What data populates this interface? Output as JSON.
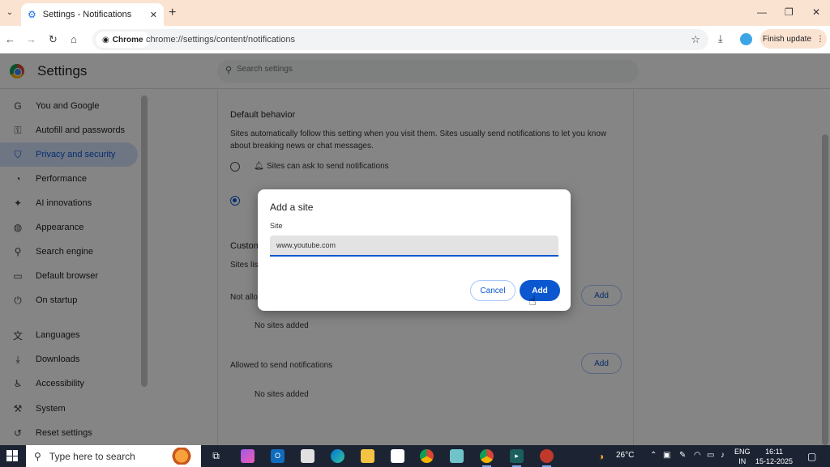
{
  "browser": {
    "tab_title": "Settings - Notifications",
    "site_chip": "Chrome",
    "url": "chrome://settings/content/notifications",
    "finish_update": "Finish update"
  },
  "settings": {
    "title": "Settings",
    "search_placeholder": "Search settings",
    "sidebar": [
      {
        "label": "You and Google",
        "icon": "google-icon"
      },
      {
        "label": "Autofill and passwords",
        "icon": "key-icon"
      },
      {
        "label": "Privacy and security",
        "icon": "shield-icon"
      },
      {
        "label": "Performance",
        "icon": "speedometer-icon"
      },
      {
        "label": "AI innovations",
        "icon": "sparkle-icon"
      },
      {
        "label": "Appearance",
        "icon": "palette-icon"
      },
      {
        "label": "Search engine",
        "icon": "search-icon"
      },
      {
        "label": "Default browser",
        "icon": "browser-icon"
      },
      {
        "label": "On startup",
        "icon": "power-icon"
      },
      {
        "label": "Languages",
        "icon": "translate-icon"
      },
      {
        "label": "Downloads",
        "icon": "download-icon"
      },
      {
        "label": "Accessibility",
        "icon": "accessibility-icon"
      },
      {
        "label": "System",
        "icon": "wrench-icon"
      },
      {
        "label": "Reset settings",
        "icon": "reset-icon"
      }
    ],
    "content": {
      "default_behavior": "Default behavior",
      "desc_line1": "Sites automatically follow this setting when you visit them. Sites usually send notifications to let you know",
      "desc_line2": "about breaking news or chat messages.",
      "option1": "Sites can ask to send notifications",
      "custom_prefix": "Custom",
      "sites_prefix": "Sites lis",
      "not_allowed_prefix": "Not allo",
      "no_sites_1": "No sites added",
      "allowed": "Allowed to send notifications",
      "no_sites_2": "No sites added",
      "add": "Add"
    }
  },
  "dialog": {
    "title": "Add a site",
    "label": "Site",
    "value": "www.youtube.com",
    "cancel": "Cancel",
    "add": "Add"
  },
  "taskbar": {
    "search_placeholder": "Type here to search",
    "weather": "26°C",
    "lang_line1": "ENG",
    "lang_line2": "IN",
    "time": "16:11",
    "date": "15-12-2025"
  }
}
